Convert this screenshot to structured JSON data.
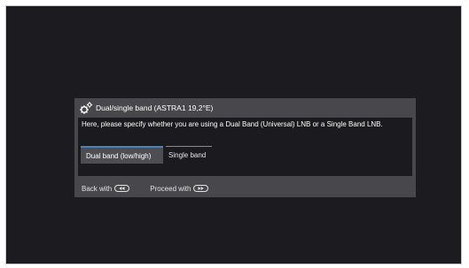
{
  "dialog": {
    "title": "Dual/single band (ASTRA1 19,2°E)",
    "title_icon": "gears-icon",
    "description": "Here, please specify whether you are using a Dual Band (Universal) LNB or a Single Band LNB.",
    "options": [
      {
        "label": "Dual band (low/high)",
        "selected": true
      },
      {
        "label": "Single band",
        "selected": false
      }
    ],
    "footer": {
      "back_label": "Back with",
      "back_icon": "rewind-key-icon",
      "proceed_label": "Proceed with",
      "proceed_icon": "fast-forward-key-icon"
    }
  },
  "colors": {
    "screen_background": "#1c1b1f",
    "dialog_frame": "#48474b",
    "dialog_body": "#1b1a1e",
    "selection_accent": "#4f80b5"
  }
}
